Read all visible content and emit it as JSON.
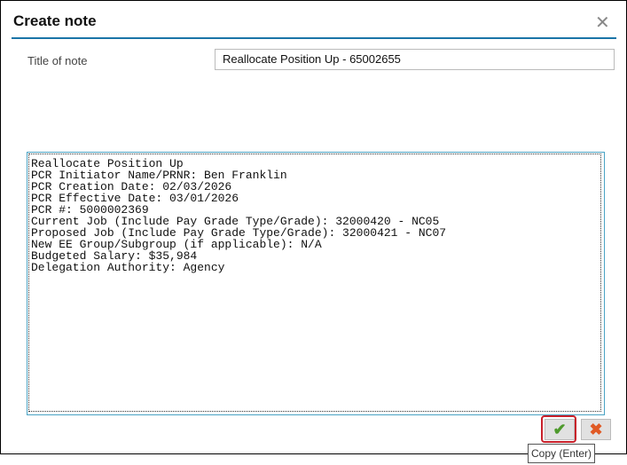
{
  "dialog": {
    "title": "Create note",
    "close_icon": "close-icon"
  },
  "form": {
    "title_label": "Title of note",
    "title_value": "Reallocate Position Up - 65002655",
    "body_value": "Reallocate Position Up\nPCR Initiator Name/PRNR: Ben Franklin\nPCR Creation Date: 02/03/2026\nPCR Effective Date: 03/01/2026\nPCR #: 5000002369\nCurrent Job (Include Pay Grade Type/Grade): 32000420 - NC05\nProposed Job (Include Pay Grade Type/Grade): 32000421 - NC07\nNew EE Group/Subgroup (if applicable): N/A\nBudgeted Salary: $35,984\nDelegation Authority: Agency"
  },
  "buttons": {
    "ok_icon": "✔",
    "cancel_icon": "✖",
    "tooltip": "Copy (Enter)"
  },
  "colors": {
    "accent": "#1a75a8",
    "ok": "#4e9a2c",
    "cancel": "#e05a25",
    "focus": "#c8202a"
  }
}
